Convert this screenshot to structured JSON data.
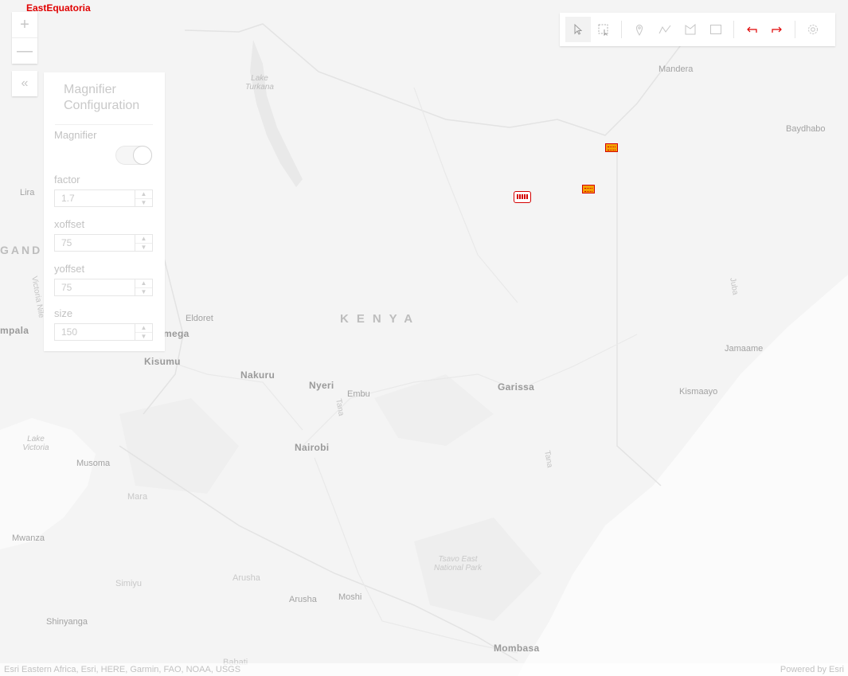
{
  "top_label": "EastEquatoria",
  "map": {
    "labels": {
      "mandera": "Mandera",
      "baydhabo": "Baydhabo",
      "lira": "Lira",
      "ganda": "GAND",
      "kampala": "mpala",
      "eldoret": "Eldoret",
      "kakamega": "mega",
      "kisumu": "Kisumu",
      "kenya": "KENYA",
      "nakuru": "Nakuru",
      "nyeri": "Nyeri",
      "embu": "Embu",
      "garissa": "Garissa",
      "jamaame": "Jamaame",
      "kismaayo": "Kismaayo",
      "nairobi": "Nairobi",
      "musoma": "Musoma",
      "mara": "Mara",
      "mwanza": "Mwanza",
      "simiyu": "Simiyu",
      "arusha_region": "Arusha",
      "arusha": "Arusha",
      "moshi": "Moshi",
      "shinyanga": "Shinyanga",
      "mombasa": "Mombasa",
      "tsavo": "Tsavo East National Park",
      "lake_victoria": "Lake Victoria",
      "lake_turkana": "Lake Turkana",
      "juba_river": "Juba",
      "tana_river": "Tana",
      "tana_river2": "Tana",
      "victoria_nile": "Victoria Nile",
      "babati": "Babati"
    }
  },
  "zoom": {
    "in": "+",
    "out": "—"
  },
  "collapse": "«",
  "toolbar": {
    "items": [
      "select-icon",
      "rectangle-select-icon",
      "point-icon",
      "polyline-icon",
      "polygon-icon",
      "rectangle-icon",
      "undo-icon",
      "redo-icon",
      "settings-icon"
    ]
  },
  "panel": {
    "title": "Magnifier Configuration",
    "magnifier_label": "Magnifier",
    "magnifier_on": true,
    "fields": [
      {
        "label": "factor",
        "value": "1.7"
      },
      {
        "label": "xoffset",
        "value": "75"
      },
      {
        "label": "yoffset",
        "value": "75"
      },
      {
        "label": "size",
        "value": "150"
      }
    ]
  },
  "attribution": {
    "left": "Esri Eastern Africa, Esri, HERE, Garmin, FAO, NOAA, USGS",
    "right": "Powered by Esri"
  },
  "colors": {
    "accent": "#e00000",
    "marker_fill": "#f4a000"
  }
}
